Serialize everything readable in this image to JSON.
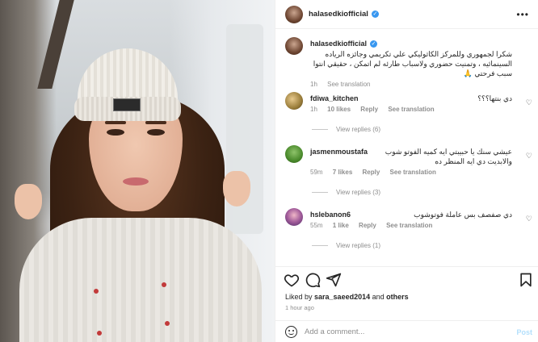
{
  "header": {
    "username": "halasedkiofficial",
    "more_label": "•••"
  },
  "caption": {
    "username": "halasedkiofficial",
    "text": "شكرا لجمهوري وللمركز الكاثوليكي علي تكريمي وجائزه الرياده السينمائيه ، وتمنيت حضوري ولاسباب طارئه لم اتمكن ، حقيقي انتوا سبب فرحتي 🙏",
    "time": "1h",
    "see_translation": "See translation"
  },
  "comments": [
    {
      "username": "fdiwa_kitchen",
      "text": "دي بنتها؟؟؟",
      "time": "1h",
      "likes": "10 likes",
      "reply": "Reply",
      "see_translation": "See translation",
      "view_replies": "View replies (6)"
    },
    {
      "username": "jasmenmoustafa",
      "text": "عيشي سنك يا حبيبتي ايه كميه الفوتو شوب والابديت دي ايه المنظر ده",
      "time": "59m",
      "likes": "7 likes",
      "reply": "Reply",
      "see_translation": "See translation",
      "view_replies": "View replies (3)"
    },
    {
      "username": "hslebanon6",
      "text": "دي صفصف بس عاملة فوتوشوب",
      "time": "55m",
      "likes": "1 like",
      "reply": "Reply",
      "see_translation": "See translation",
      "view_replies": "View replies (1)"
    }
  ],
  "likes": {
    "prefix": "Liked by ",
    "user": "sara_saeed2014",
    "middle": " and ",
    "others": "others"
  },
  "post_age": "1 hour ago",
  "add_comment": {
    "placeholder": "Add a comment...",
    "post_label": "Post"
  },
  "colors": {
    "verified": "#3897f0",
    "post_disabled": "#b2dffc",
    "secondary_text": "#8e8e8e"
  },
  "icons": [
    "heart-icon",
    "comment-icon",
    "share-icon",
    "bookmark-icon",
    "emoji-icon",
    "more-icon",
    "verified-icon"
  ]
}
